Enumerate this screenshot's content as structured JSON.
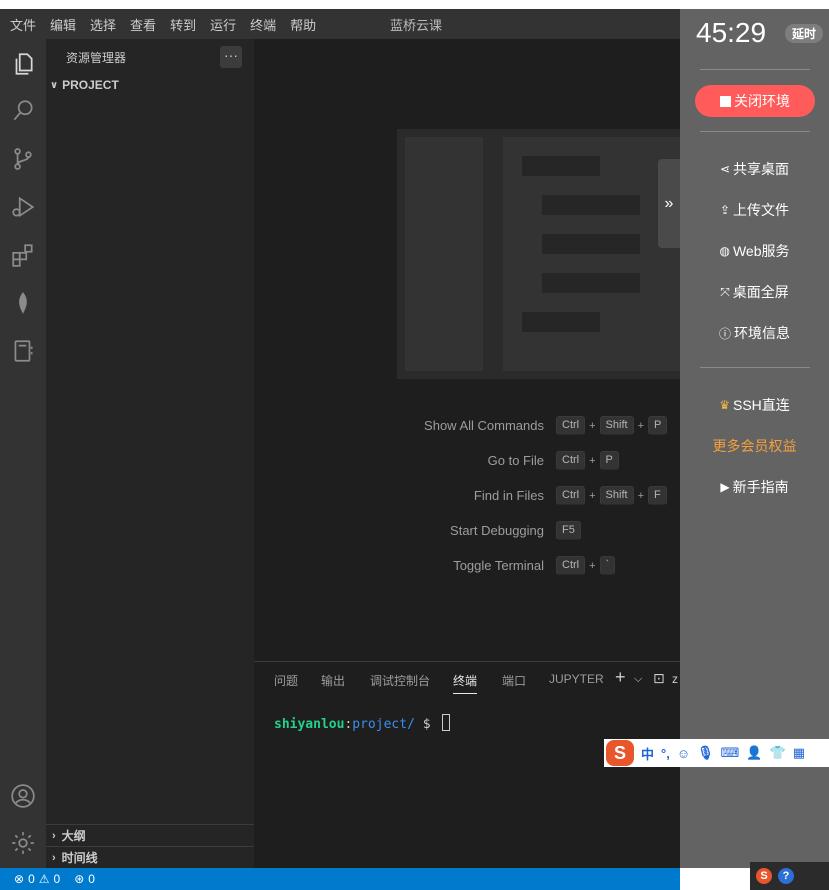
{
  "menubar": {
    "items": [
      "文件",
      "编辑",
      "选择",
      "查看",
      "转到",
      "运行",
      "终端",
      "帮助"
    ],
    "window_title": "蓝桥云课"
  },
  "activity_bar": {
    "icons": [
      "files-icon",
      "search-icon",
      "source-control-icon",
      "run-debug-icon",
      "extensions-icon",
      "leaf-icon",
      "notebook-icon",
      "account-icon",
      "settings-gear-icon"
    ]
  },
  "sidebar": {
    "title": "资源管理器",
    "more": "···",
    "project": "PROJECT",
    "outline": "大纲",
    "timeline": "时间线"
  },
  "welcome": {
    "shortcuts": [
      {
        "label": "Show All Commands",
        "keys": [
          "Ctrl",
          "Shift",
          "P"
        ]
      },
      {
        "label": "Go to File",
        "keys": [
          "Ctrl",
          "P"
        ]
      },
      {
        "label": "Find in Files",
        "keys": [
          "Ctrl",
          "Shift",
          "F"
        ]
      },
      {
        "label": "Start Debugging",
        "keys": [
          "F5"
        ]
      },
      {
        "label": "Toggle Terminal",
        "keys": [
          "Ctrl",
          "`"
        ]
      }
    ],
    "plus": "+"
  },
  "panel": {
    "tabs": [
      "问题",
      "输出",
      "调试控制台",
      "终端",
      "端口",
      "JUPYTER"
    ],
    "active_tab": "终端",
    "add": "+",
    "dropdown": "⌵",
    "terminal_icon": "⊡",
    "terminal_name_fragment": "z"
  },
  "terminal": {
    "user": "shiyanlou",
    "colon": ":",
    "path": "project/",
    "prompt": "$"
  },
  "statusbar": {
    "errors": "0",
    "warnings": "0",
    "ports": "0"
  },
  "right_panel": {
    "timer": "45:29",
    "delay_badge": "延时",
    "close_env": "关闭环境",
    "share_desktop": "共享桌面",
    "upload_file": "上传文件",
    "web_service": "Web服务",
    "fullscreen": "桌面全屏",
    "env_info": "环境信息",
    "ssh": "SSH直连",
    "member": "更多会员权益",
    "guide": "新手指南",
    "collapse": "»"
  },
  "ime": {
    "logo": "S",
    "lang": "中",
    "punct": "°,",
    "emoji": "☺",
    "mic": "🎙",
    "keyboard": "⌨",
    "user": "👤",
    "skin": "👕",
    "tools": "▦"
  },
  "tray": {
    "sogou": "S",
    "help": "?"
  },
  "colors": {
    "activity_bg": "#333333",
    "sidebar_bg": "#252526",
    "editor_bg": "#1e1e1e",
    "statusbar_bg": "#007acc",
    "close_button": "#ff5b5b",
    "member_text": "#f5a03c",
    "terminal_user": "#23d18b",
    "terminal_path": "#3b8eea"
  }
}
